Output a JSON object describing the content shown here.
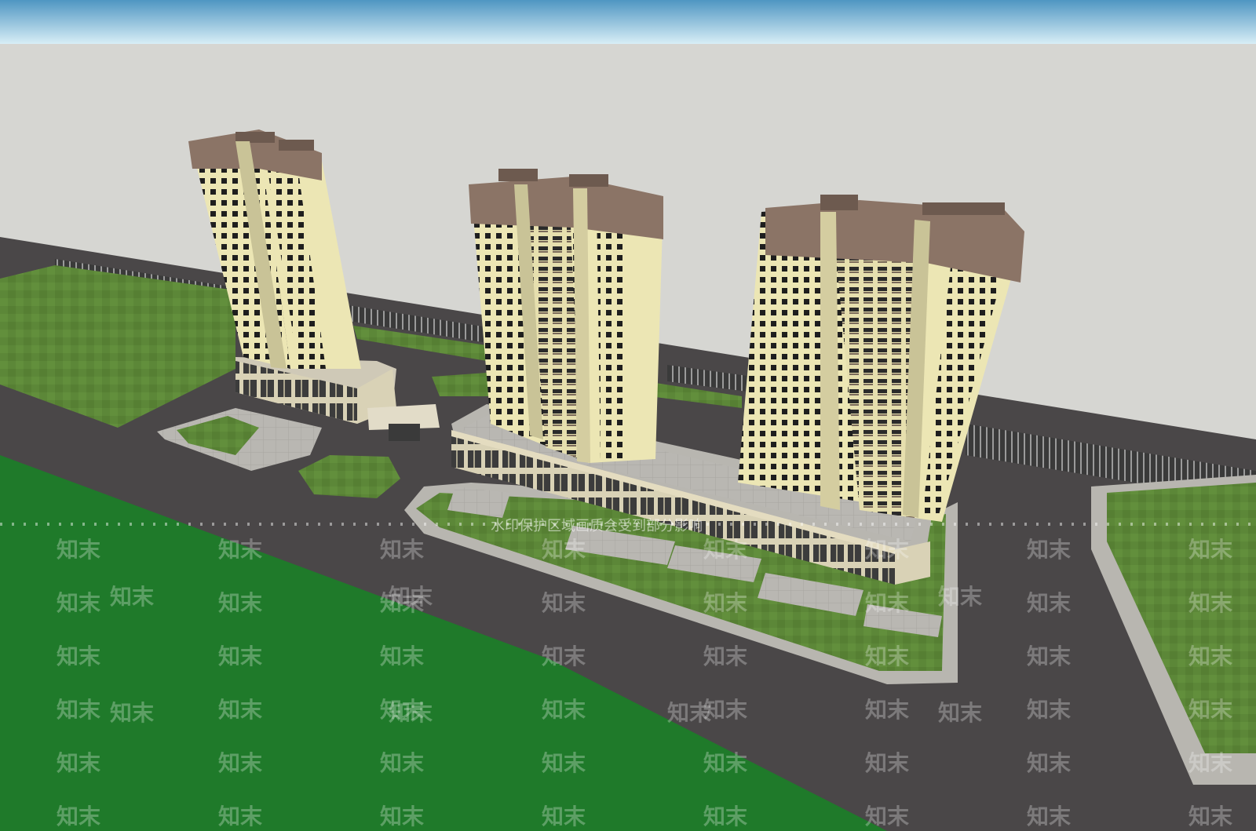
{
  "watermark": {
    "logo_text": "知末",
    "banner_text": "水印保护区域画质会受到部分影响"
  },
  "palette": {
    "sky_top": "#5a9ec8",
    "sky_bottom": "#d4ecf4",
    "background": "#d6d6d2",
    "asphalt": "#4a4748",
    "grass": "#5f8a3a",
    "grass_bright": "#1f7a2a",
    "facade": "#ece6b4",
    "facade_shadow": "#c9c397",
    "crown": "#8b7466",
    "podium": "#e4dcc0",
    "pavement": "#b8b6b0"
  },
  "scene": {
    "description_items": [
      "tower-1",
      "tower-2",
      "tower-3",
      "podium",
      "road",
      "lawns",
      "rail-track"
    ]
  }
}
